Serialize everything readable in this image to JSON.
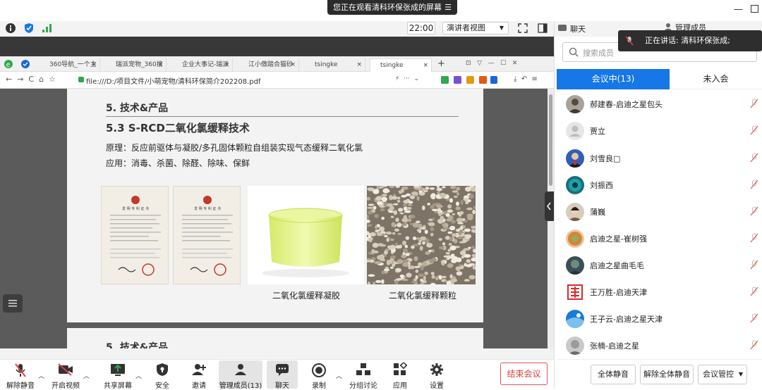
{
  "banner": {
    "text": "您正在观看清科环保张成的屏幕",
    "menu": "☰"
  },
  "meeting_bar": {
    "time": "22:00",
    "presenter_view": "演讲者视图"
  },
  "browser": {
    "tabs": [
      {
        "label": "360导航_一个主"
      },
      {
        "label": "瑞派宠物_360搜"
      },
      {
        "label": "企业大事记-瑞派"
      },
      {
        "label": "江小傲踏合猫砂"
      },
      {
        "label": "tsingke"
      },
      {
        "label": "tsingke"
      }
    ],
    "url": "file:///D:/项目文件/小萌宠物/清科环保简介202208.pdf"
  },
  "slide": {
    "section": "5. 技术&产品",
    "heading": "5.3 S-RCD二氧化氯缓释技术",
    "principle": "原理：反应前驱体与凝胶/多孔固体颗粒自组装实现气态缓释二氧化氯",
    "application": "应用：消毒、杀菌、除醛、除味、保鲜",
    "cert_title": "发 明 专 利 证 书",
    "caption_gel": "二氧化氯缓释凝胶",
    "caption_granule": "二氧化氯缓释颗粒",
    "next_section": "5. 技术&产品"
  },
  "toolbar": {
    "unmute": "解除静音",
    "video": "开启视频",
    "share": "共享屏幕",
    "security": "安全",
    "invite": "邀请",
    "members": "管理成员(13)",
    "chat": "聊天",
    "record": "录制",
    "breakout": "分组讨论",
    "apps": "应用",
    "settings": "设置",
    "end": "结束会议"
  },
  "right": {
    "chat_title": "聊天",
    "manage_title": "管理成员",
    "speaking": "正在讲话: 清科环保张成;",
    "search_placeholder": "搜索成员",
    "tab_in": "会议中(13)",
    "tab_out": "未入会",
    "members": [
      {
        "name": "郝建春-启迪之星包头"
      },
      {
        "name": "贾立"
      },
      {
        "name": "刘雪良□"
      },
      {
        "name": "刘振西"
      },
      {
        "name": "蒲巍"
      },
      {
        "name": "启迪之星-崔树强"
      },
      {
        "name": "启迪之星曲毛毛"
      },
      {
        "name": "王万胜-启迪天津"
      },
      {
        "name": "王子云-启迪之星天津"
      },
      {
        "name": "张楠-启迪之星"
      }
    ],
    "mute_all": "全体静音",
    "unmute_all": "解除全体静音",
    "control": "会议管控"
  },
  "colors": {
    "accent": "#1677e6",
    "end_red": "#e04040",
    "toolbar_green": "#2ea84f"
  }
}
